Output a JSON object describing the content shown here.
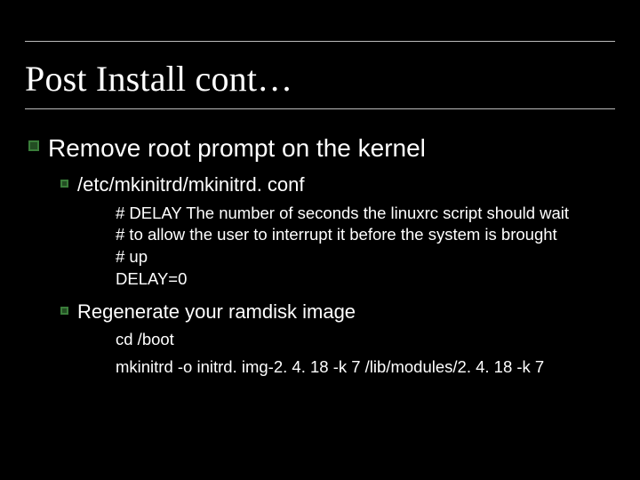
{
  "title": "Post Install cont…",
  "bullet1": "Remove root prompt on the kernel",
  "sub1": "/etc/mkinitrd/mkinitrd. conf",
  "code": {
    "l1": "# DELAY The number of seconds the linuxrc script should wait",
    "l2": "# to allow the user to interrupt it before the system is brought",
    "l3": "# up",
    "l4": "DELAY=0"
  },
  "sub2": "Regenerate your ramdisk image",
  "sub2_lines": {
    "l1": "cd /boot",
    "l2": "mkinitrd -o initrd. img-2. 4. 18 -k 7 /lib/modules/2. 4. 18 -k 7"
  }
}
